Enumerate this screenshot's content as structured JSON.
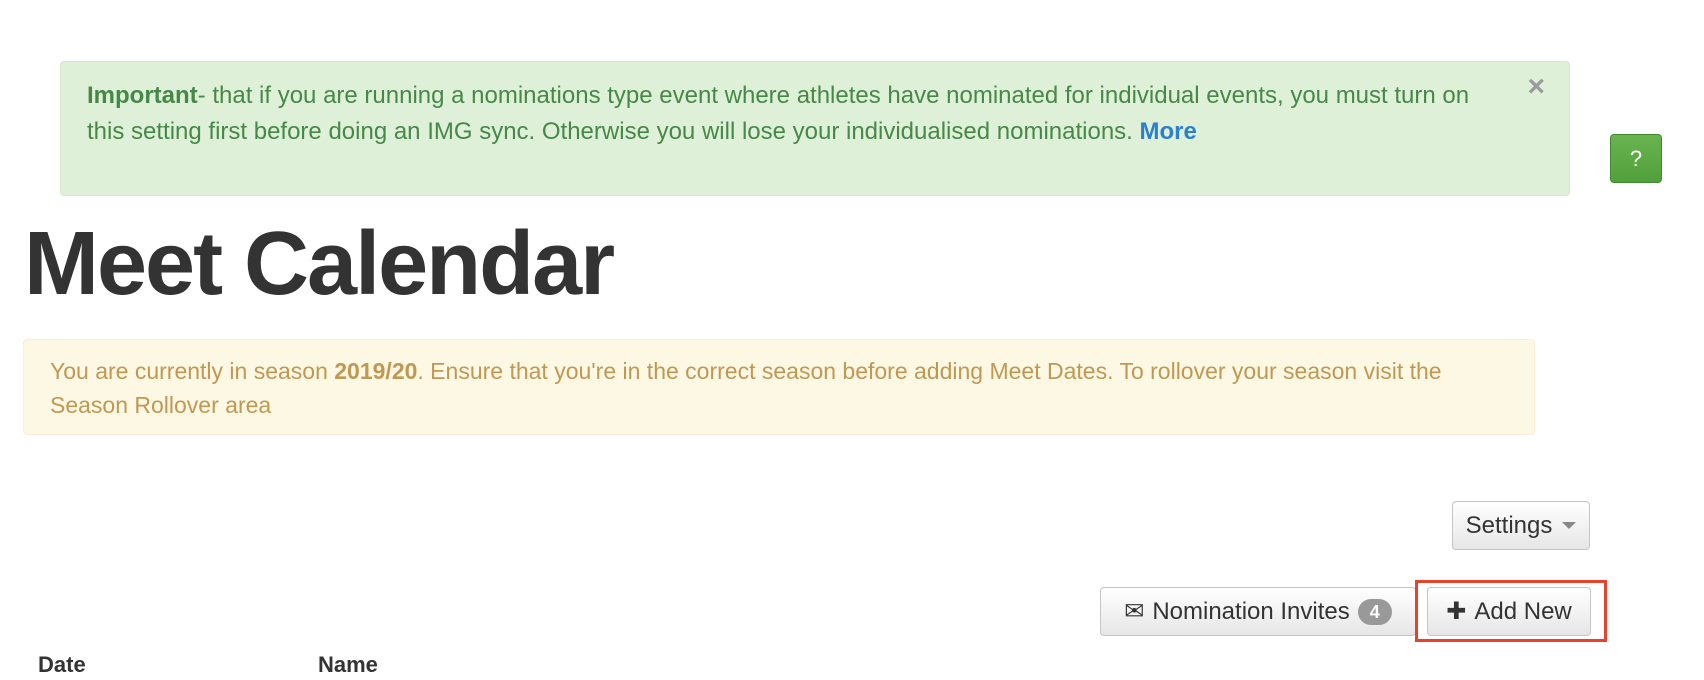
{
  "notice": {
    "strong": "Important",
    "text": "- that if you are running a nominations type event where athletes have nominated for individual events, you must turn on this setting first before doing an IMG sync. Otherwise you will lose your individualised nominations. ",
    "more_label": "More",
    "close_symbol": "×"
  },
  "help_button": {
    "label": "?"
  },
  "page_title": "Meet Calendar",
  "season_warning": {
    "prefix": "You are currently in season ",
    "season": "2019/20",
    "suffix": ". Ensure that you're in the correct season before adding Meet Dates. To rollover your season visit the Season Rollover area"
  },
  "toolbar": {
    "settings_label": "Settings",
    "nomination_invites_label": "Nomination Invites",
    "nomination_invites_count": "4",
    "add_new_label": "Add New",
    "envelope_glyph": "✉",
    "plus_glyph": "✚"
  },
  "table": {
    "columns": [
      "Date",
      "Name"
    ]
  },
  "colors": {
    "success_bg": "#dff0d8",
    "warning_bg": "#fcf8e3",
    "help_green": "#5cad46",
    "link_blue": "#2a7fce",
    "highlight_red": "#e8412c"
  }
}
